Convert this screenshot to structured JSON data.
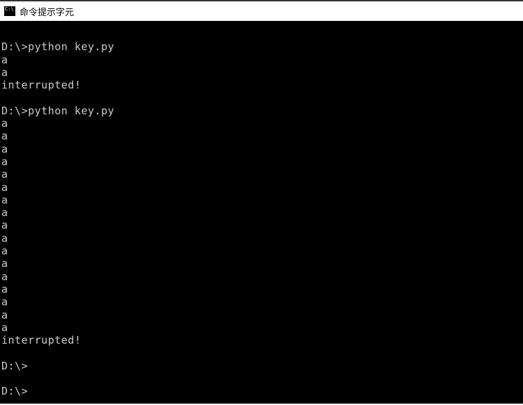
{
  "window": {
    "title": "命令提示字元"
  },
  "terminal": {
    "lines": [
      "",
      "D:\\>python key.py",
      "a",
      "a",
      "interrupted!",
      "",
      "D:\\>python key.py",
      "a",
      "a",
      "a",
      "a",
      "a",
      "a",
      "a",
      "a",
      "a",
      "a",
      "a",
      "a",
      "a",
      "a",
      "a",
      "a",
      "a",
      "interrupted!",
      "",
      "D:\\>",
      "",
      "D:\\>"
    ]
  }
}
